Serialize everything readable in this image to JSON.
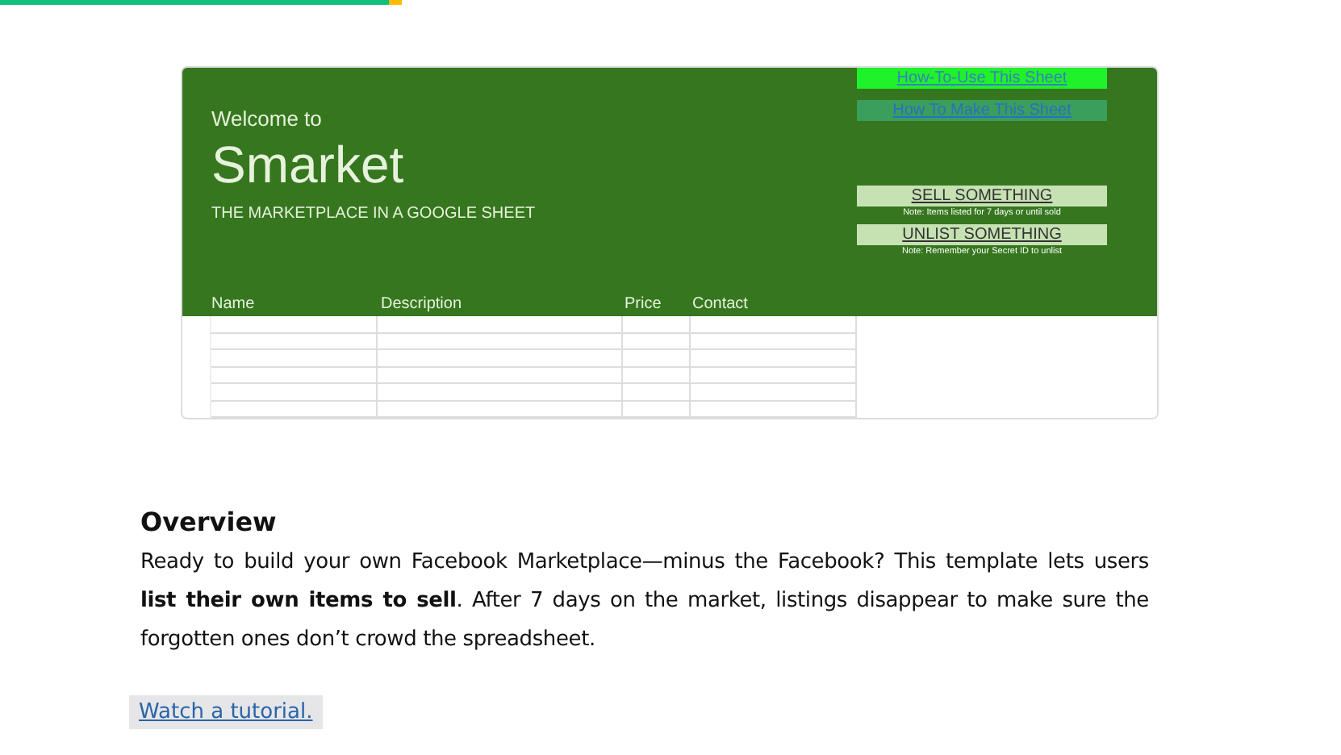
{
  "reading_progress": {
    "level": 0.3
  },
  "sheet": {
    "welcome": "Welcome to",
    "title": "Smarket",
    "subtitle": "THE MARKETPLACE IN A GOOGLE SHEET",
    "columns": [
      "Name",
      "Description",
      "Price",
      "Contact"
    ],
    "buttons": [
      {
        "label": "How-To-Use This Sheet",
        "kind": "highlight"
      },
      {
        "label": "How To Make This Sheet",
        "kind": "link"
      },
      {
        "label": "SELL SOMETHING",
        "kind": "action",
        "note": "Note: Items listed for 7 days or until sold"
      },
      {
        "label": "UNLIST SOMETHING",
        "kind": "action",
        "note": "Note: Remember your Secret ID to unlist"
      }
    ]
  },
  "overview": {
    "heading": "Overview",
    "text": "Ready to build your own Facebook Marketplace—minus the Facebook? This template lets users **list their own items to sell**. After 7 days on the market, listings disappear to make sure the forgotten ones don’t crowd the spreadsheet.",
    "link": "Watch a tutorial."
  }
}
